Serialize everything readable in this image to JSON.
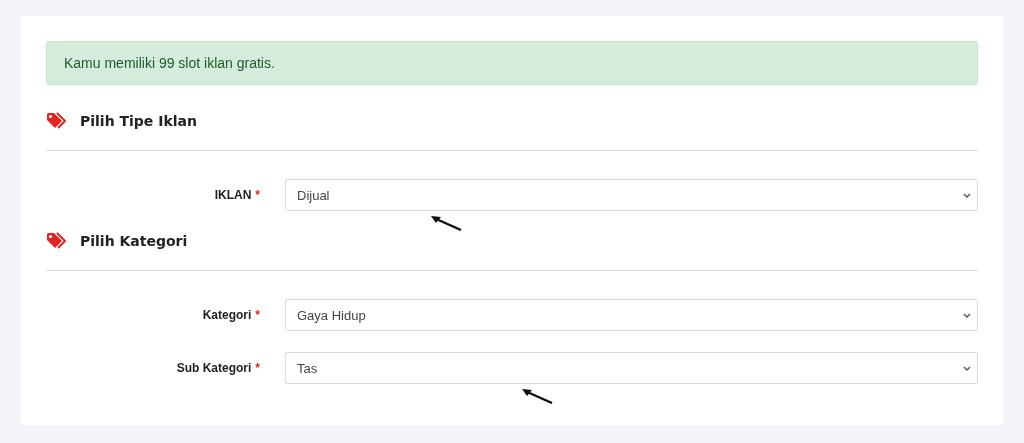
{
  "alert": {
    "text": "Kamu memiliki 99 slot iklan gratis."
  },
  "sections": [
    {
      "title": "Pilih Tipe Iklan",
      "fields": [
        {
          "label": "IKLAN",
          "required_mark": "*",
          "value": "Dijual",
          "arrow": true
        }
      ]
    },
    {
      "title": "Pilih Kategori",
      "fields": [
        {
          "label": "Kategori",
          "required_mark": "*",
          "value": "Gaya Hidup",
          "arrow": false
        },
        {
          "label": "Sub Kategori",
          "required_mark": "*",
          "value": "Tas",
          "arrow": true
        }
      ]
    }
  ]
}
